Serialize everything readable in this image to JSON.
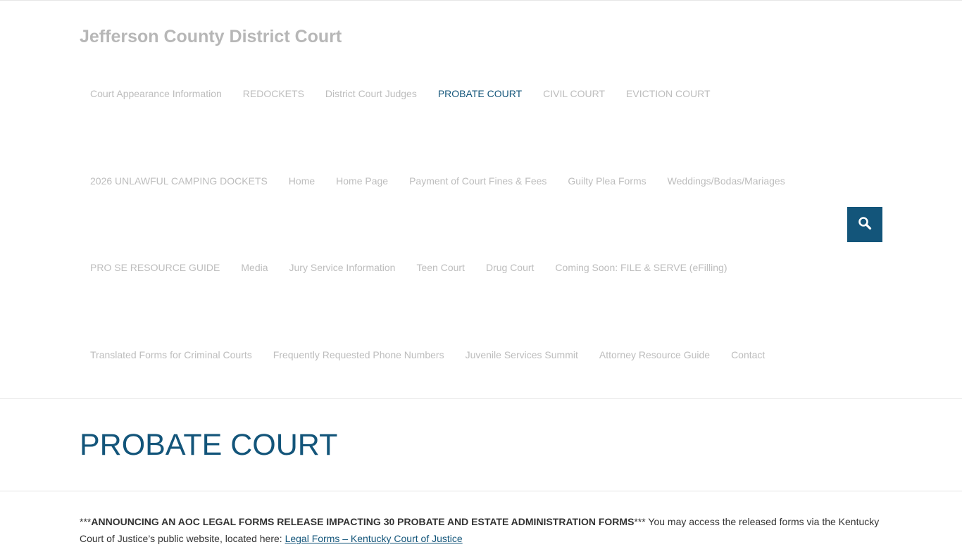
{
  "site": {
    "title": "Jefferson County District Court"
  },
  "nav": {
    "row1": [
      {
        "label": "Court Appearance Information",
        "name": "nav-item-court-appearance-information",
        "active": false
      },
      {
        "label": "REDOCKETS",
        "name": "nav-item-redockets",
        "active": false
      },
      {
        "label": "District Court Judges",
        "name": "nav-item-district-court-judges",
        "active": false
      },
      {
        "label": "PROBATE COURT",
        "name": "nav-item-probate-court",
        "active": true
      },
      {
        "label": "CIVIL COURT",
        "name": "nav-item-civil-court",
        "active": false
      },
      {
        "label": "EVICTION COURT",
        "name": "nav-item-eviction-court",
        "active": false
      }
    ],
    "row2": [
      {
        "label": "2026 UNLAWFUL CAMPING DOCKETS",
        "name": "nav-item-unlawful-camping-dockets",
        "active": false
      },
      {
        "label": "Home",
        "name": "nav-item-home",
        "active": false
      },
      {
        "label": "Home Page",
        "name": "nav-item-home-page",
        "active": false
      },
      {
        "label": "Payment of Court Fines & Fees",
        "name": "nav-item-payment-of-court-fines",
        "active": false
      },
      {
        "label": "Guilty Plea Forms",
        "name": "nav-item-guilty-plea-forms",
        "active": false
      },
      {
        "label": "Weddings/Bodas/Mariages",
        "name": "nav-item-weddings",
        "active": false
      }
    ],
    "row3": [
      {
        "label": "PRO SE RESOURCE GUIDE",
        "name": "nav-item-pro-se-resource-guide",
        "active": false
      },
      {
        "label": "Media",
        "name": "nav-item-media",
        "active": false
      },
      {
        "label": "Jury Service Information",
        "name": "nav-item-jury-service-information",
        "active": false
      },
      {
        "label": "Teen Court",
        "name": "nav-item-teen-court",
        "active": false
      },
      {
        "label": "Drug Court",
        "name": "nav-item-drug-court",
        "active": false
      },
      {
        "label": "Coming Soon: FILE & SERVE (eFilling)",
        "name": "nav-item-file-and-serve",
        "active": false
      }
    ],
    "row4": [
      {
        "label": "Translated Forms for Criminal Courts",
        "name": "nav-item-translated-forms",
        "active": false
      },
      {
        "label": "Frequently Requested Phone Numbers",
        "name": "nav-item-phone-numbers",
        "active": false
      },
      {
        "label": "Juvenile Services Summit",
        "name": "nav-item-juvenile-services-summit",
        "active": false
      },
      {
        "label": "Attorney Resource Guide",
        "name": "nav-item-attorney-resource-guide",
        "active": false
      },
      {
        "label": "Contact",
        "name": "nav-item-contact",
        "active": false
      }
    ]
  },
  "search": {
    "icon": "search-icon"
  },
  "page": {
    "title": "PROBATE COURT"
  },
  "content": {
    "prefix": "***",
    "announcement": "ANNOUNCING AN AOC LEGAL FORMS RELEASE IMPACTING 30 PROBATE AND ESTATE ADMINISTRATION FORMS",
    "suffix": "*** You may access the released forms via the Kentucky Court of Justice’s public website, located here: ",
    "link_text": "Legal Forms – Kentucky Court of Justice"
  },
  "colors": {
    "accent": "#13557a",
    "nav_text": "#bdbdbd",
    "site_title": "#b7b7b7"
  }
}
